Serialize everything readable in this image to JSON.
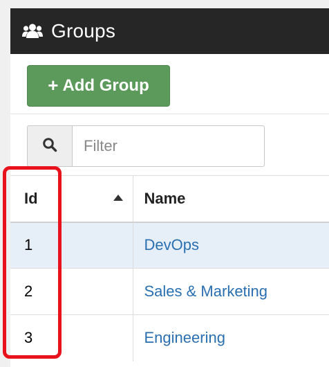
{
  "header": {
    "title": "Groups",
    "icon": "users-icon",
    "background": "#262626"
  },
  "toolbar": {
    "add_button_label": "Add Group",
    "add_button_icon": "plus-icon",
    "accent": "#5c9a5c"
  },
  "filter": {
    "placeholder": "Filter",
    "value": "",
    "icon": "search-icon"
  },
  "table": {
    "columns": [
      {
        "label": "Id",
        "sorted": "ascending"
      },
      {
        "label": "Name"
      }
    ],
    "rows": [
      {
        "id": "1",
        "name": "DevOps",
        "selected": true
      },
      {
        "id": "2",
        "name": "Sales & Marketing",
        "selected": false
      },
      {
        "id": "3",
        "name": "Engineering",
        "selected": false
      }
    ],
    "link_color": "#2a6fb0"
  },
  "annotation": {
    "color": "#e8121c"
  }
}
